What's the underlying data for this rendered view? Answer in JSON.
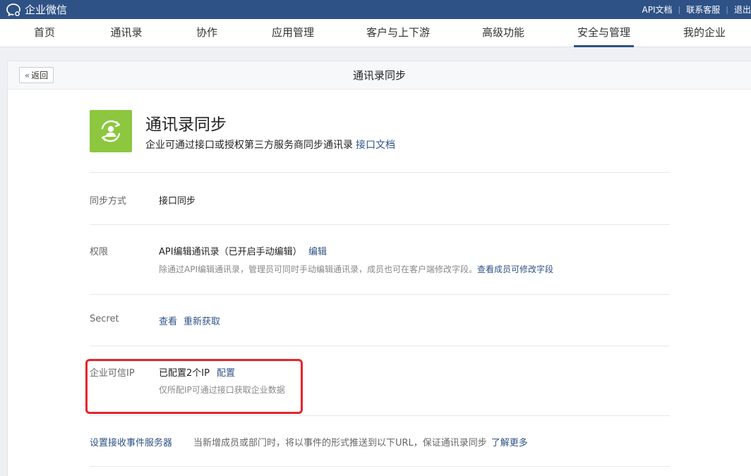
{
  "topbar": {
    "logo_text": "企业微信",
    "links": [
      "API文档",
      "联系客服",
      "退出"
    ]
  },
  "nav": {
    "items": [
      "首页",
      "通讯录",
      "协作",
      "应用管理",
      "客户与上下游",
      "高级功能",
      "安全与管理",
      "我的企业"
    ],
    "active": "安全与管理"
  },
  "card": {
    "back_label": "返回",
    "title": "通讯录同步"
  },
  "app": {
    "name": "通讯录同步",
    "description": "企业可通过接口或授权第三方服务商同步通讯录",
    "doc_link": "接口文档",
    "icon": "sync-user-icon",
    "icon_color": "#8cc73f"
  },
  "sync_mode": {
    "label": "同步方式",
    "value": "接口同步"
  },
  "permission": {
    "label": "权限",
    "value": "API编辑通讯录（已开启手动编辑）",
    "edit_link": "编辑",
    "note": "除通过API编辑通讯录，管理员可同时手动编辑通讯录，成员也可在客户端修改字段。",
    "note_link": "查看成员可修改字段"
  },
  "secret": {
    "label": "Secret",
    "view_link": "查看",
    "refresh_link": "重新获取"
  },
  "trusted_ip": {
    "label": "企业可信IP",
    "value": "已配置2个IP",
    "config_link": "配置",
    "note": "仅所配IP可通过接口获取企业数据"
  },
  "event_server": {
    "label": "设置接收事件服务器",
    "description": "当新增成员或部门时，将以事件的形式推送到以下URL，保证通讯录同步",
    "more_link": "了解更多"
  },
  "colors": {
    "brand": "#2f5286",
    "highlight": "#e8232a"
  }
}
